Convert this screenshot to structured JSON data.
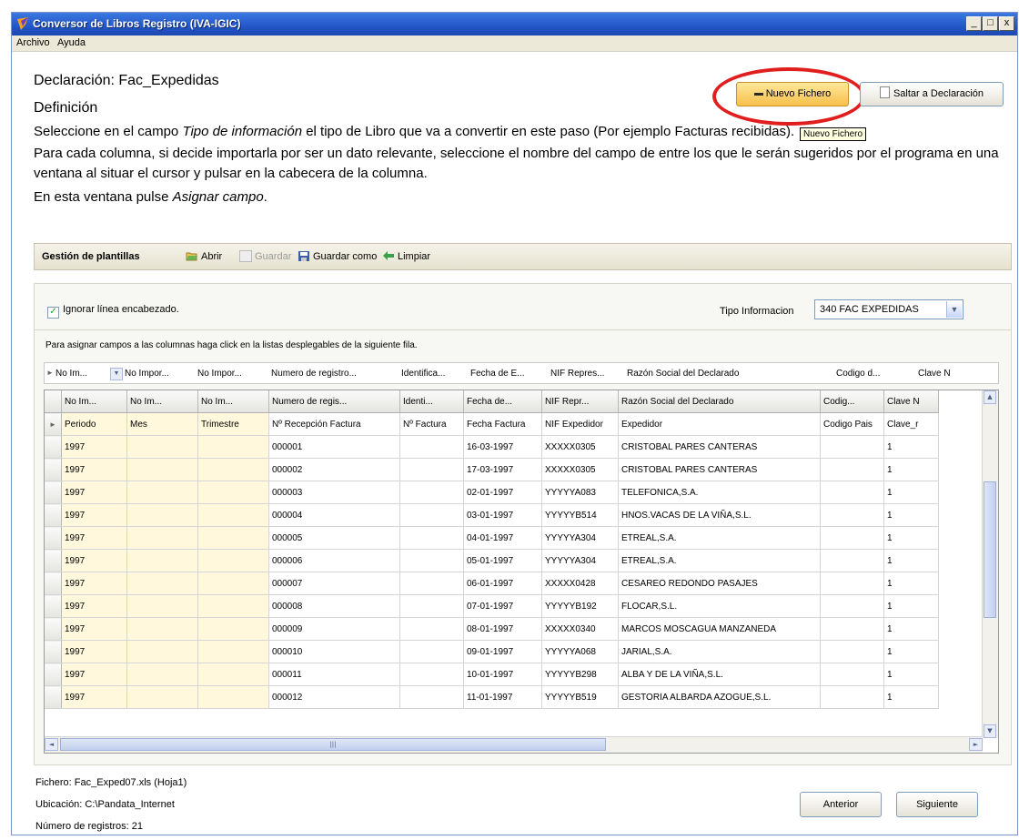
{
  "window": {
    "title": "Conversor de Libros Registro (IVA-IGIC)",
    "buttons": [
      "_",
      "□",
      "x"
    ]
  },
  "menu": {
    "archivo": "Archivo",
    "ayuda": "Ayuda"
  },
  "header": {
    "declaracion": "Declaración: Fac_Expedidas",
    "definicion": "Definición",
    "nuevo_fichero": "Nuevo Fichero",
    "saltar": "Saltar a Declaración",
    "tooltip": "Nuevo Fichero"
  },
  "instructions": {
    "p1_a": "Seleccione en el campo ",
    "p1_em": "Tipo de información",
    "p1_b": " el tipo de Libro que va a convertir en este paso (Por ejemplo Facturas recibidas).",
    "p2": "Para cada columna, si decide importarla por ser un dato relevante, seleccione el nombre del campo de entre los que le serán sugeridos por el programa en una ventana al situar el cursor y pulsar en la cabecera de la columna.",
    "p3_a": "En esta ventana pulse ",
    "p3_em": "Asignar campo",
    "p3_b": "."
  },
  "toolbar": {
    "title": "Gestión de plantillas",
    "abrir": "Abrir",
    "guardar": "Guardar",
    "guardar_como": "Guardar como",
    "limpiar": "Limpiar"
  },
  "options": {
    "ignorar": "Ignorar línea encabezado.",
    "ignorar_checked": true,
    "tipo_label": "Tipo Informacion",
    "tipo_value": "340 FAC EXPEDIDAS"
  },
  "grid_instruction": "Para asignar campos a las columnas haga click en la listas desplegables de la siguiente fila.",
  "mapping_row": [
    "No Im...",
    "No Impor...",
    "No Impor...",
    "Numero de registro...",
    "Identifica...",
    "Fecha de E...",
    "NIF Repres...",
    "Razón Social del Declarado",
    "Codigo d...",
    "Clave N"
  ],
  "grid": {
    "headers": [
      "No Im...",
      "No Im...",
      "No Im...",
      "Numero de regis...",
      "Identi...",
      "Fecha de...",
      "NIF Repr...",
      "Razón Social del Declarado",
      "Codig...",
      "Clave N"
    ],
    "first_row": [
      "Periodo",
      "Mes",
      "Trimestre",
      "Nº Recepción Factura",
      "Nº Factura",
      "Fecha Factura",
      "NIF Expedidor",
      "Expedidor",
      "Codigo Pais",
      "Clave_r"
    ],
    "rows": [
      [
        "1997",
        "",
        "",
        "000001",
        "",
        "16-03-1997",
        "XXXXX0305",
        "CRISTOBAL PARES CANTERAS",
        "",
        "1"
      ],
      [
        "1997",
        "",
        "",
        "000002",
        "",
        "17-03-1997",
        "XXXXX0305",
        "CRISTOBAL PARES CANTERAS",
        "",
        "1"
      ],
      [
        "1997",
        "",
        "",
        "000003",
        "",
        "02-01-1997",
        "YYYYYA083",
        "TELEFONICA,S.A.",
        "",
        "1"
      ],
      [
        "1997",
        "",
        "",
        "000004",
        "",
        "03-01-1997",
        "YYYYYB514",
        "HNOS.VACAS DE LA VIÑA,S.L.",
        "",
        "1"
      ],
      [
        "1997",
        "",
        "",
        "000005",
        "",
        "04-01-1997",
        "YYYYYA304",
        "ETREAL,S.A.",
        "",
        "1"
      ],
      [
        "1997",
        "",
        "",
        "000006",
        "",
        "05-01-1997",
        "YYYYYA304",
        "ETREAL,S.A.",
        "",
        "1"
      ],
      [
        "1997",
        "",
        "",
        "000007",
        "",
        "06-01-1997",
        "XXXXX0428",
        "CESAREO REDONDO PASAJES",
        "",
        "1"
      ],
      [
        "1997",
        "",
        "",
        "000008",
        "",
        "07-01-1997",
        "YYYYYB192",
        "FLOCAR,S.L.",
        "",
        "1"
      ],
      [
        "1997",
        "",
        "",
        "000009",
        "",
        "08-01-1997",
        "XXXXX0340",
        "MARCOS MOSCAGUA MANZANEDA",
        "",
        "1"
      ],
      [
        "1997",
        "",
        "",
        "000010",
        "",
        "09-01-1997",
        "YYYYYA068",
        "JARIAL,S.A.",
        "",
        "1"
      ],
      [
        "1997",
        "",
        "",
        "000011",
        "",
        "10-01-1997",
        "YYYYYB298",
        "ALBA Y DE LA VIÑA,S.L.",
        "",
        "1"
      ],
      [
        "1997",
        "",
        "",
        "000012",
        "",
        "11-01-1997",
        "YYYYYB519",
        "GESTORIA ALBARDA AZOGUE,S.L.",
        "",
        "1"
      ]
    ]
  },
  "footer": {
    "fichero": "Fichero: Fac_Exped07.xls (Hoja1)",
    "ubicacion": "Ubicación: C:\\Pandata_Internet",
    "registros": "Número de registros: 21",
    "anterior": "Anterior",
    "siguiente": "Siguiente"
  },
  "colors": {
    "titlebar": "#2456c8",
    "highlight": "#e01e1e",
    "nuevo_button": "#f6c04c",
    "yellow_column": "#fff8dc"
  }
}
